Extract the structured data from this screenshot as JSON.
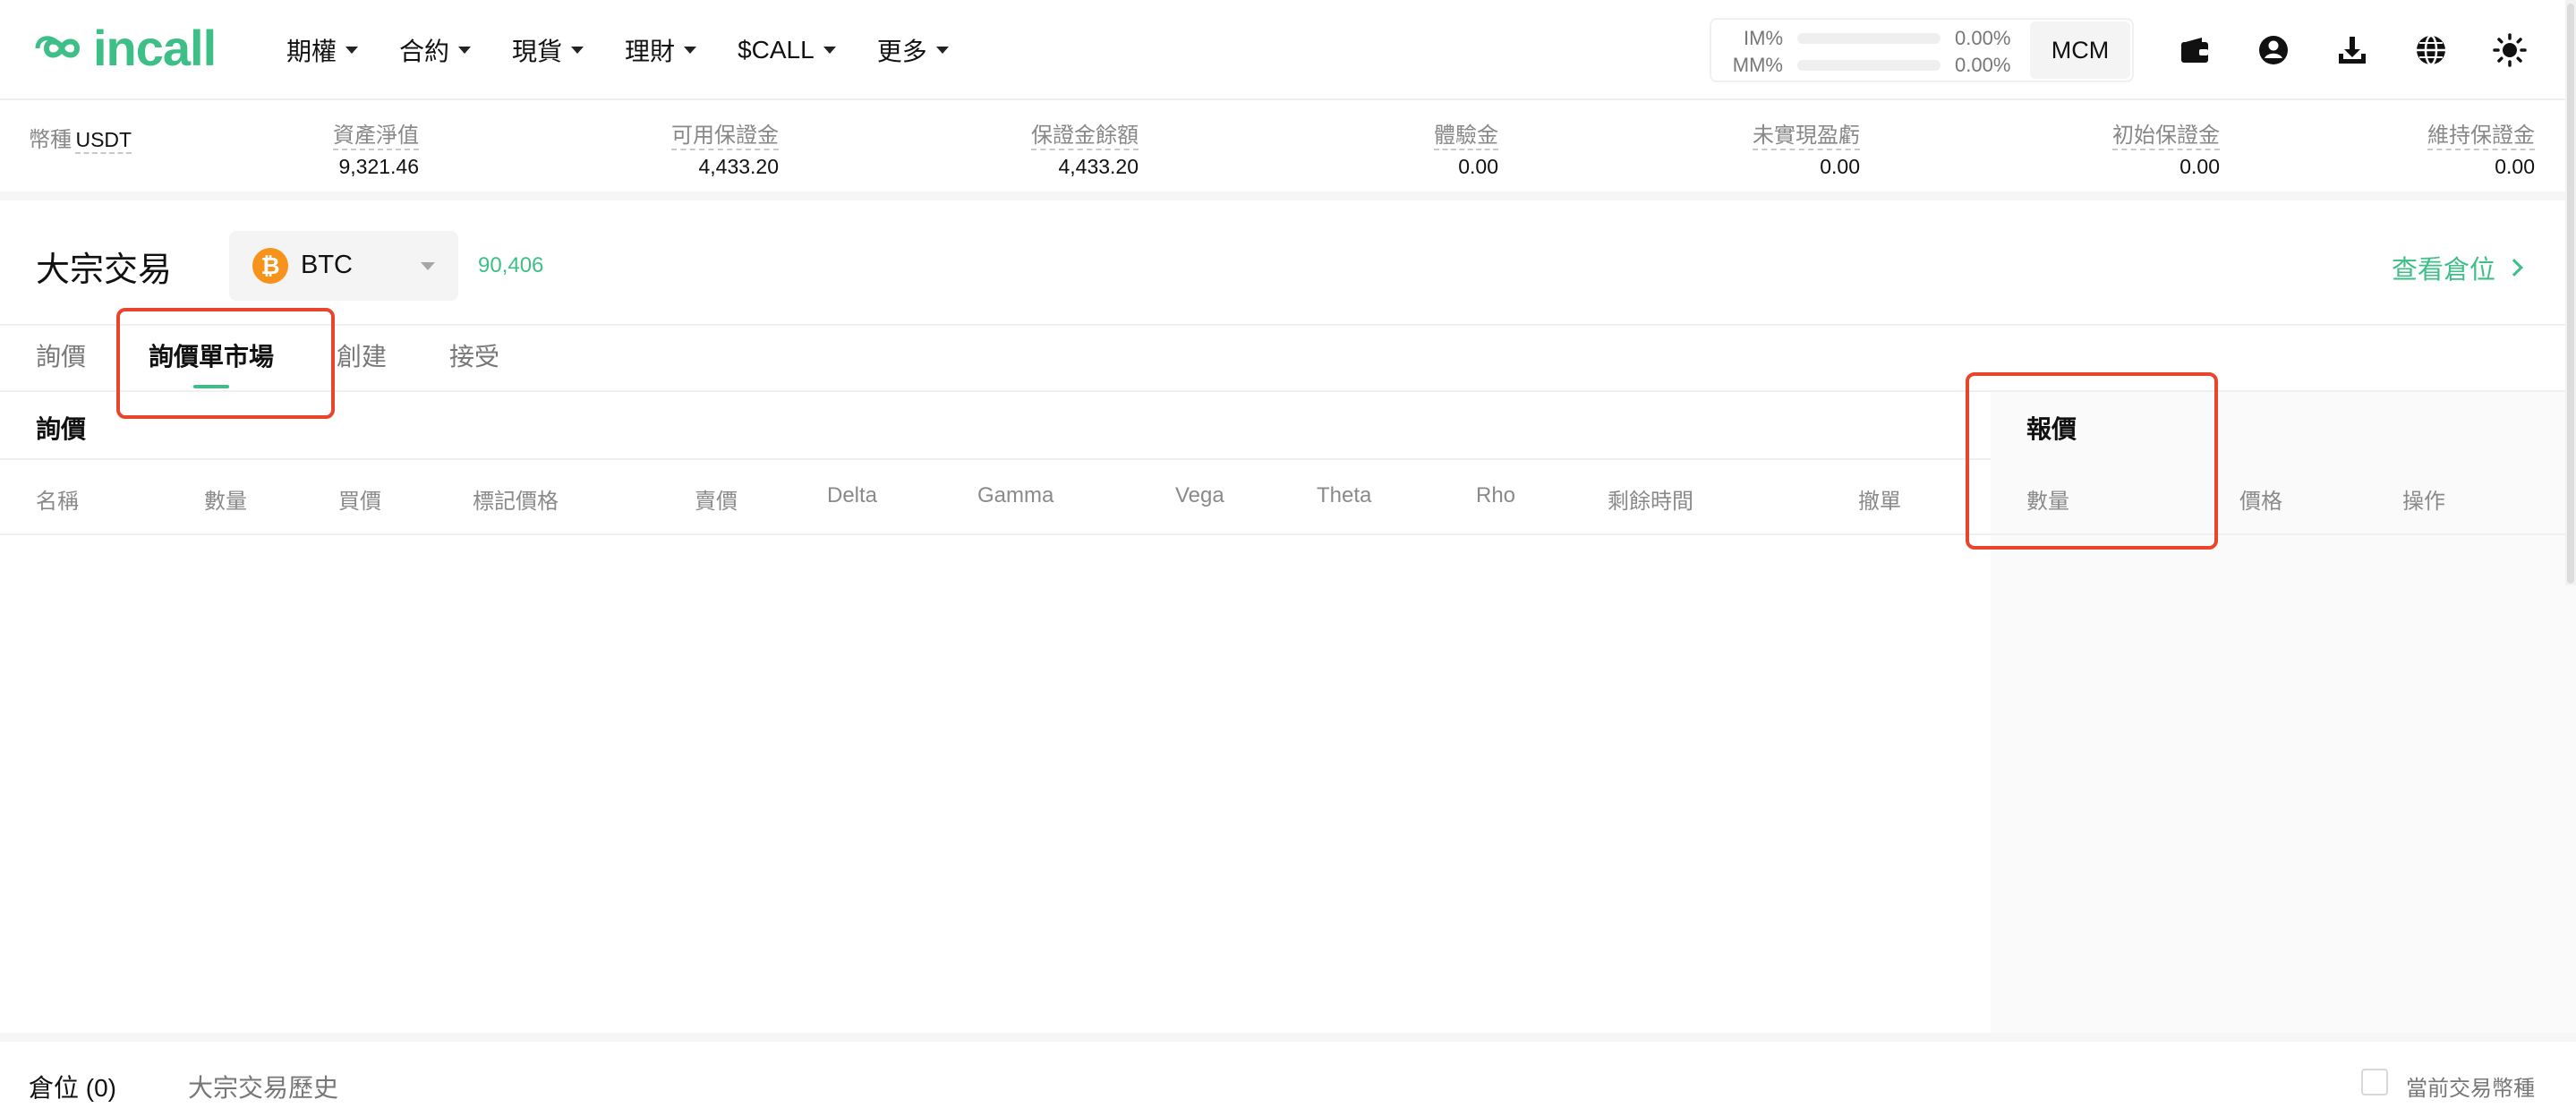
{
  "brand": {
    "name": "incall",
    "color": "#3dbf87"
  },
  "nav": [
    {
      "label": "期權"
    },
    {
      "label": "合約"
    },
    {
      "label": "現貨"
    },
    {
      "label": "理財"
    },
    {
      "label": "$CALL"
    },
    {
      "label": "更多"
    }
  ],
  "margin": {
    "im_label": "IM%",
    "im_value": "0.00%",
    "im_fill": 0,
    "mm_label": "MM%",
    "mm_value": "0.00%",
    "mm_fill": 0,
    "mode_button": "MCM"
  },
  "top_icons": [
    "wallet-icon",
    "account-icon",
    "download-icon",
    "globe-icon",
    "theme-sun-icon"
  ],
  "account": [
    {
      "label": "幣種",
      "value": "USDT"
    },
    {
      "label": "資產淨值",
      "value": "9,321.46"
    },
    {
      "label": "可用保證金",
      "value": "4,433.20"
    },
    {
      "label": "保證金餘額",
      "value": "4,433.20"
    },
    {
      "label": "體驗金",
      "value": "0.00"
    },
    {
      "label": "未實現盈虧",
      "value": "0.00"
    },
    {
      "label": "初始保證金",
      "value": "0.00"
    },
    {
      "label": "維持保證金",
      "value": "0.00"
    }
  ],
  "page": {
    "title": "大宗交易",
    "coin": "BTC",
    "coin_symbol": "₿",
    "price": "90,406",
    "view_positions": "查看倉位"
  },
  "tabs": [
    {
      "label": "詢價",
      "active": false
    },
    {
      "label": "詢價單市場",
      "active": true
    },
    {
      "label": "創建",
      "active": false
    },
    {
      "label": "接受",
      "active": false
    }
  ],
  "inquiry": {
    "title": "詢價",
    "columns": [
      "名稱",
      "數量",
      "買價",
      "標記價格",
      "賣價",
      "Delta",
      "Gamma",
      "Vega",
      "Theta",
      "Rho",
      "剩餘時間",
      "撤單"
    ]
  },
  "quote": {
    "title": "報價",
    "columns": [
      "數量",
      "價格",
      "操作"
    ]
  },
  "bottom": {
    "tabs": [
      {
        "label": "倉位 (0)",
        "active": true
      },
      {
        "label": "大宗交易歷史",
        "active": false
      }
    ],
    "filter_label": "當前交易幣種",
    "filter_checked": false
  },
  "colors": {
    "accent": "#3dbf87",
    "highlight": "#e8452c",
    "btc": "#f7931a"
  }
}
